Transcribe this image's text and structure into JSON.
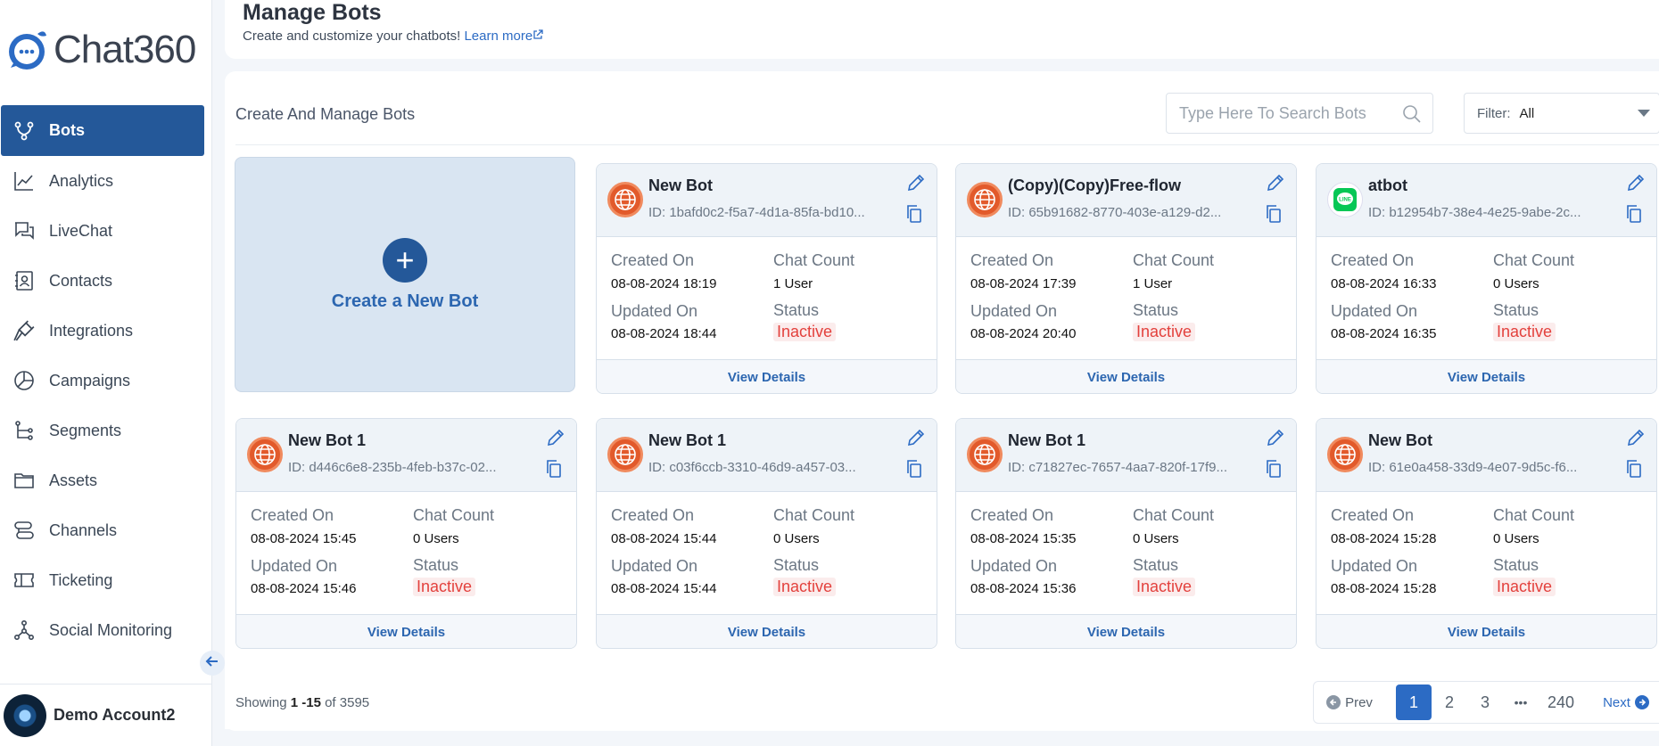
{
  "brand": {
    "name": "Chat360"
  },
  "sidebar": {
    "items": [
      {
        "label": "Bots",
        "icon": "bots-flow-icon",
        "active": true
      },
      {
        "label": "Analytics",
        "icon": "analytics-chart-icon"
      },
      {
        "label": "LiveChat",
        "icon": "livechat-bubbles-icon"
      },
      {
        "label": "Contacts",
        "icon": "contacts-card-icon"
      },
      {
        "label": "Integrations",
        "icon": "plug-icon"
      },
      {
        "label": "Campaigns",
        "icon": "pie-chart-icon"
      },
      {
        "label": "Segments",
        "icon": "segments-tree-icon"
      },
      {
        "label": "Assets",
        "icon": "folder-icon"
      },
      {
        "label": "Channels",
        "icon": "channels-icon"
      },
      {
        "label": "Ticketing",
        "icon": "ticket-icon"
      },
      {
        "label": "Social Monitoring",
        "icon": "network-icon"
      }
    ],
    "account_name": "Demo Account2"
  },
  "header": {
    "title": "Manage Bots",
    "subtitle": "Create and customize your chatbots!",
    "learn_more": "Learn more"
  },
  "panel": {
    "title": "Create And Manage Bots",
    "search_placeholder": "Type Here To Search Bots",
    "filter_label": "Filter:",
    "filter_value": "All",
    "create_label": "Create a New Bot",
    "labels": {
      "created_on": "Created On",
      "updated_on": "Updated On",
      "chat_count": "Chat Count",
      "status": "Status",
      "view_details": "View Details"
    }
  },
  "bots": [
    {
      "name": "New Bot",
      "id": "ID: 1bafd0c2-f5a7-4d1a-85fa-bd10...",
      "created": "08-08-2024 18:19",
      "updated": "08-08-2024 18:44",
      "chat_count": "1 User",
      "status": "Inactive",
      "channel": "web"
    },
    {
      "name": "(Copy)(Copy)Free-flow",
      "id": "ID: 65b91682-8770-403e-a129-d2...",
      "created": "08-08-2024 17:39",
      "updated": "08-08-2024 20:40",
      "chat_count": "1 User",
      "status": "Inactive",
      "channel": "web"
    },
    {
      "name": "atbot",
      "id": "ID: b12954b7-38e4-4e25-9abe-2c...",
      "created": "08-08-2024 16:33",
      "updated": "08-08-2024 16:35",
      "chat_count": "0 Users",
      "status": "Inactive",
      "channel": "line"
    },
    {
      "name": "New Bot 1",
      "id": "ID: d446c6e8-235b-4feb-b37c-02...",
      "created": "08-08-2024 15:45",
      "updated": "08-08-2024 15:46",
      "chat_count": "0 Users",
      "status": "Inactive",
      "channel": "web"
    },
    {
      "name": "New Bot 1",
      "id": "ID: c03f6ccb-3310-46d9-a457-03...",
      "created": "08-08-2024 15:44",
      "updated": "08-08-2024 15:44",
      "chat_count": "0 Users",
      "status": "Inactive",
      "channel": "web"
    },
    {
      "name": "New Bot 1",
      "id": "ID: c71827ec-7657-4aa7-820f-17f9...",
      "created": "08-08-2024 15:35",
      "updated": "08-08-2024 15:36",
      "chat_count": "0 Users",
      "status": "Inactive",
      "channel": "web"
    },
    {
      "name": "New Bot",
      "id": "ID: 61e0a458-33d9-4e07-9d5c-f6...",
      "created": "08-08-2024 15:28",
      "updated": "08-08-2024 15:28",
      "chat_count": "0 Users",
      "status": "Inactive",
      "channel": "web"
    }
  ],
  "pagination": {
    "showing_prefix": "Showing",
    "range": "1 -15",
    "of": "of",
    "total": "3595",
    "prev": "Prev",
    "next": "Next",
    "pages": [
      "1",
      "2",
      "3",
      "•••",
      "240"
    ],
    "current": "1"
  },
  "colors": {
    "primary": "#245899",
    "link": "#2c6bc4",
    "inactive": "#e3413d"
  }
}
